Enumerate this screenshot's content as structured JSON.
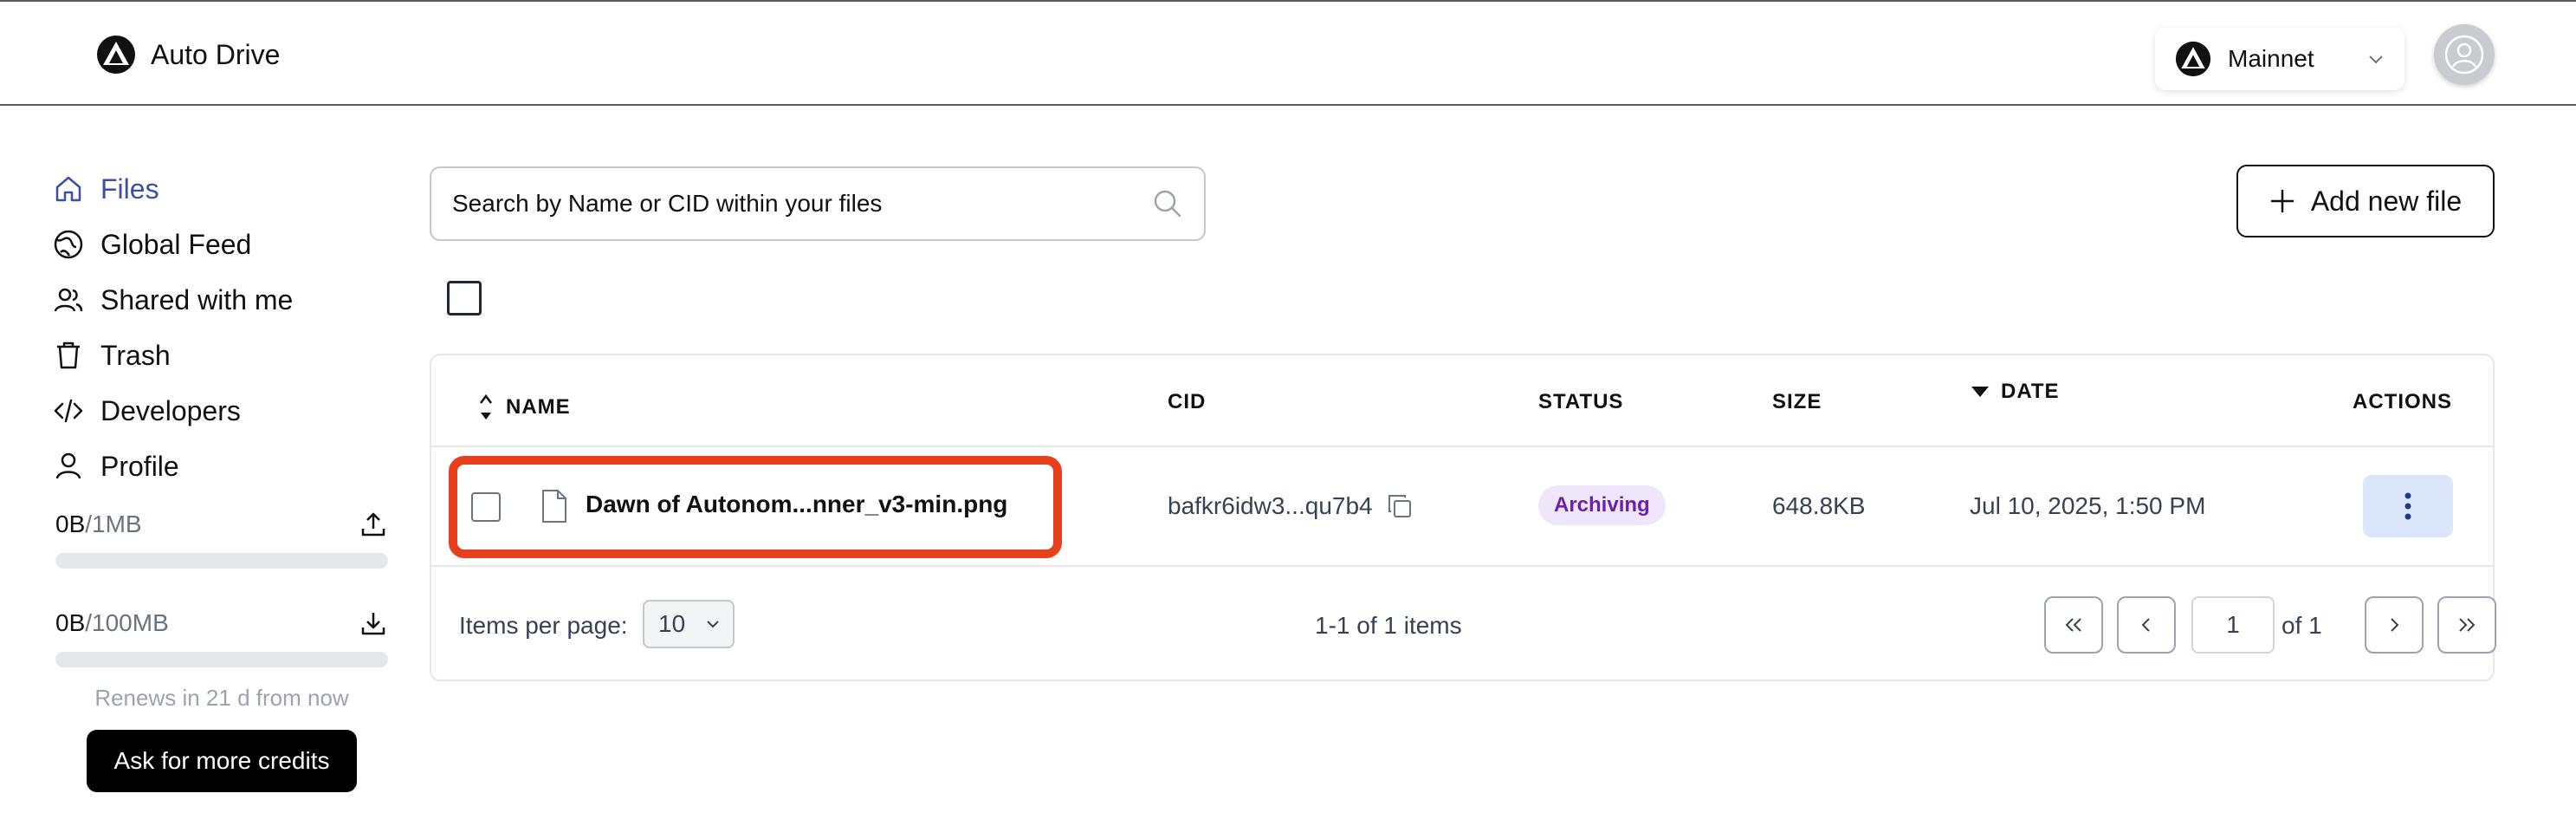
{
  "app": {
    "title": "Auto Drive"
  },
  "header": {
    "network_label": "Mainnet"
  },
  "sidebar": {
    "items": [
      {
        "label": "Files",
        "icon": "home-icon"
      },
      {
        "label": "Global Feed",
        "icon": "globe-icon"
      },
      {
        "label": "Shared with me",
        "icon": "users-icon"
      },
      {
        "label": "Trash",
        "icon": "trash-icon"
      },
      {
        "label": "Developers",
        "icon": "code-icon"
      },
      {
        "label": "Profile",
        "icon": "user-icon"
      }
    ],
    "upload_quota": {
      "used": "0B",
      "limit": "/1MB",
      "fill": 0
    },
    "download_quota": {
      "used": "0B",
      "limit": "/100MB",
      "fill": 0
    },
    "renews_text": "Renews in 21 d from now",
    "credits_button": "Ask for more credits"
  },
  "toolbar": {
    "search_placeholder": "Search by Name or CID within your files",
    "add_label": "Add new file"
  },
  "table": {
    "columns": [
      "NAME",
      "CID",
      "STATUS",
      "SIZE",
      "DATE",
      "ACTIONS"
    ],
    "rows": [
      {
        "name": "Dawn of Autonom...nner_v3-min.png",
        "cid": "bafkr6idw3...qu7b4",
        "status": "Archiving",
        "size": "648.8KB",
        "date": "Jul 10, 2025, 1:50 PM"
      }
    ]
  },
  "pagination": {
    "items_per_page_label": "Items per page:",
    "items_per_page_value": "10",
    "summary": "1-1 of 1 items",
    "current_page": "1",
    "of_label": "of 1"
  },
  "colors": {
    "accent": "#3b4ea8",
    "status_bg": "#efe6fb",
    "status_text": "#6b21a8",
    "highlight": "#e8401f"
  }
}
